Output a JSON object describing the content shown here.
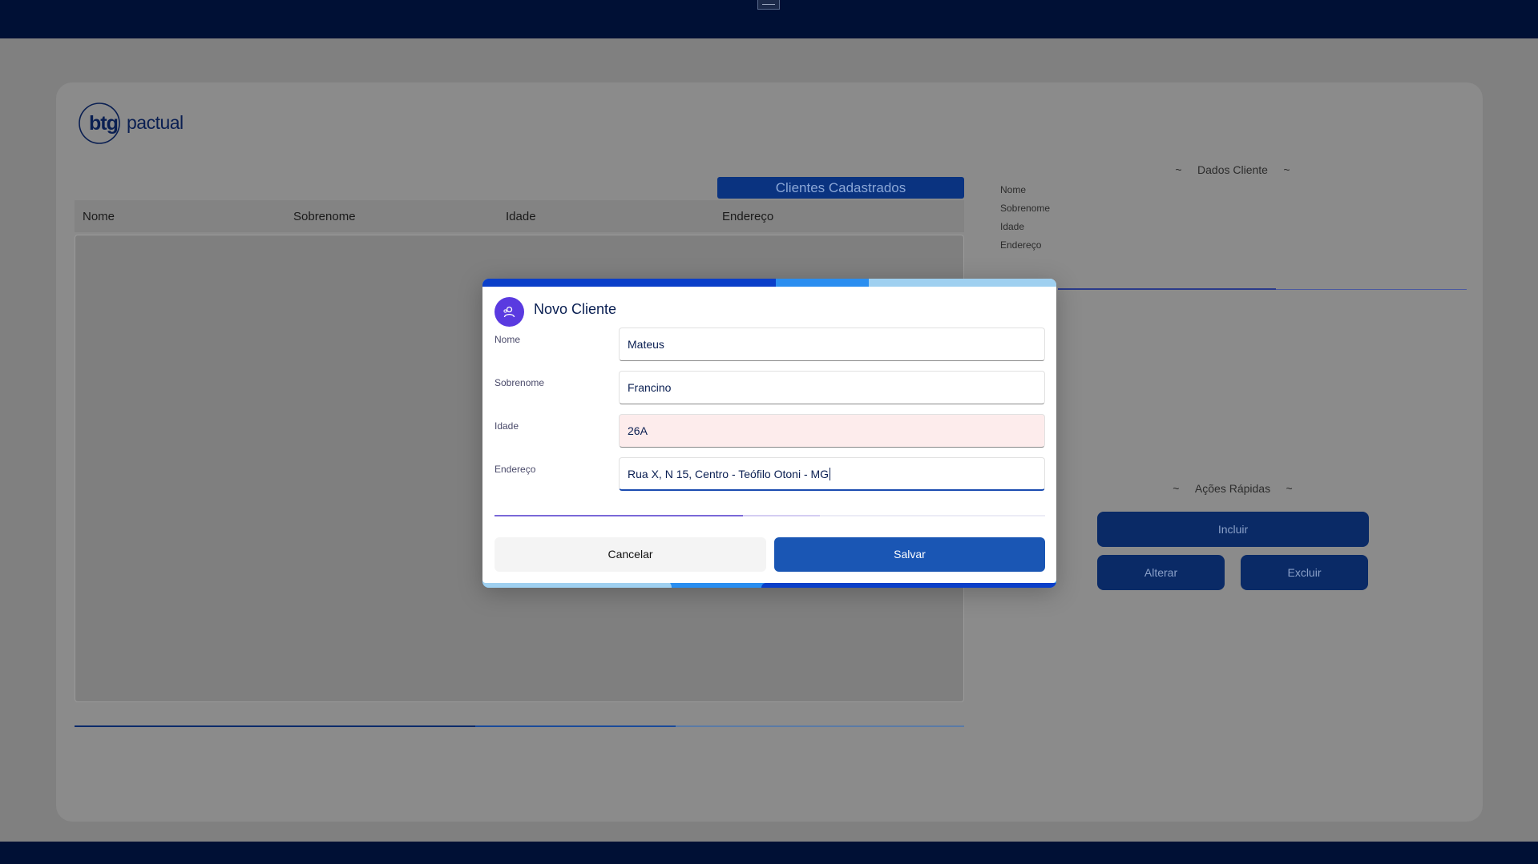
{
  "brand": {
    "logo_text": "btg pactual"
  },
  "clientes_tab": {
    "label": "Clientes Cadastrados"
  },
  "table": {
    "columns": [
      "Nome",
      "Sobrenome",
      "Idade",
      "Endereço"
    ]
  },
  "dados_cliente": {
    "title": "Dados Cliente",
    "fields": [
      "Nome",
      "Sobrenome",
      "Idade",
      "Endereço"
    ]
  },
  "acoes_rapidas": {
    "title": "Ações Rápidas",
    "incluir": "Incluir",
    "alterar": "Alterar",
    "excluir": "Excluir"
  },
  "modal": {
    "title": "Novo Cliente",
    "fields": [
      {
        "label": "Nome",
        "value": "Mateus"
      },
      {
        "label": "Sobrenome",
        "value": "Francino"
      },
      {
        "label": "Idade",
        "value": "26A"
      },
      {
        "label": "Endereço",
        "value": "Rua X, N 15, Centro - Teófilo Otoni - MG"
      }
    ],
    "cancel_label": "Cancelar",
    "save_label": "Salvar"
  },
  "colors": {
    "top_bar": "#001035",
    "accent": "#1a56b4",
    "avatar": "#5a3ae0",
    "error_field": "#fdecec"
  }
}
